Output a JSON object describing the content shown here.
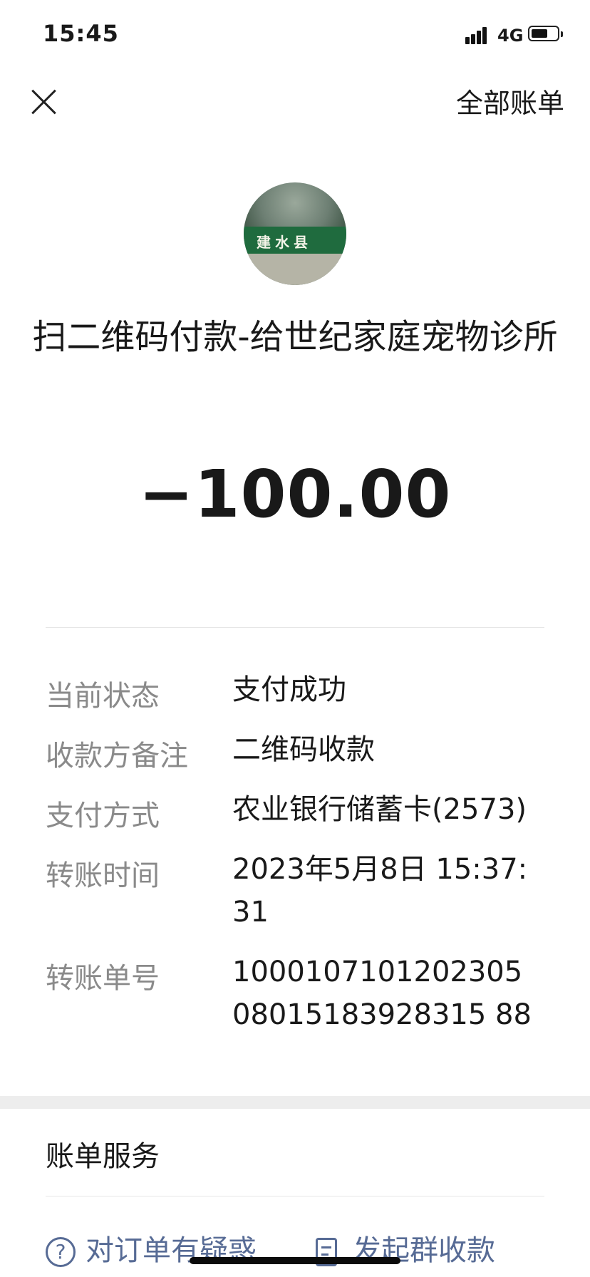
{
  "status_bar": {
    "time": "15:45",
    "network": "4G"
  },
  "header": {
    "all_bills_label": "全部账单"
  },
  "merchant": {
    "title": "扫二维码付款-给世纪家庭宠物诊所",
    "avatar_sign_text": "建水县"
  },
  "amount": "−100.00",
  "details": [
    {
      "label": "当前状态",
      "value": "支付成功"
    },
    {
      "label": "收款方备注",
      "value": "二维码收款"
    },
    {
      "label": "支付方式",
      "value": "农业银行储蓄卡(2573)"
    },
    {
      "label": "转账时间",
      "value": "2023年5月8日 15:37:31"
    },
    {
      "label": "转账单号",
      "value": "100010710120230508015183928315 88"
    }
  ],
  "service": {
    "title": "账单服务",
    "links": [
      {
        "label": "对订单有疑惑",
        "icon": "question-circle-icon"
      },
      {
        "label": "发起群收款",
        "icon": "group-receipt-icon"
      }
    ]
  },
  "colors": {
    "link": "#576b95",
    "label_gray": "#8a8a8a",
    "text": "#191919",
    "section_gap": "#ededed"
  }
}
